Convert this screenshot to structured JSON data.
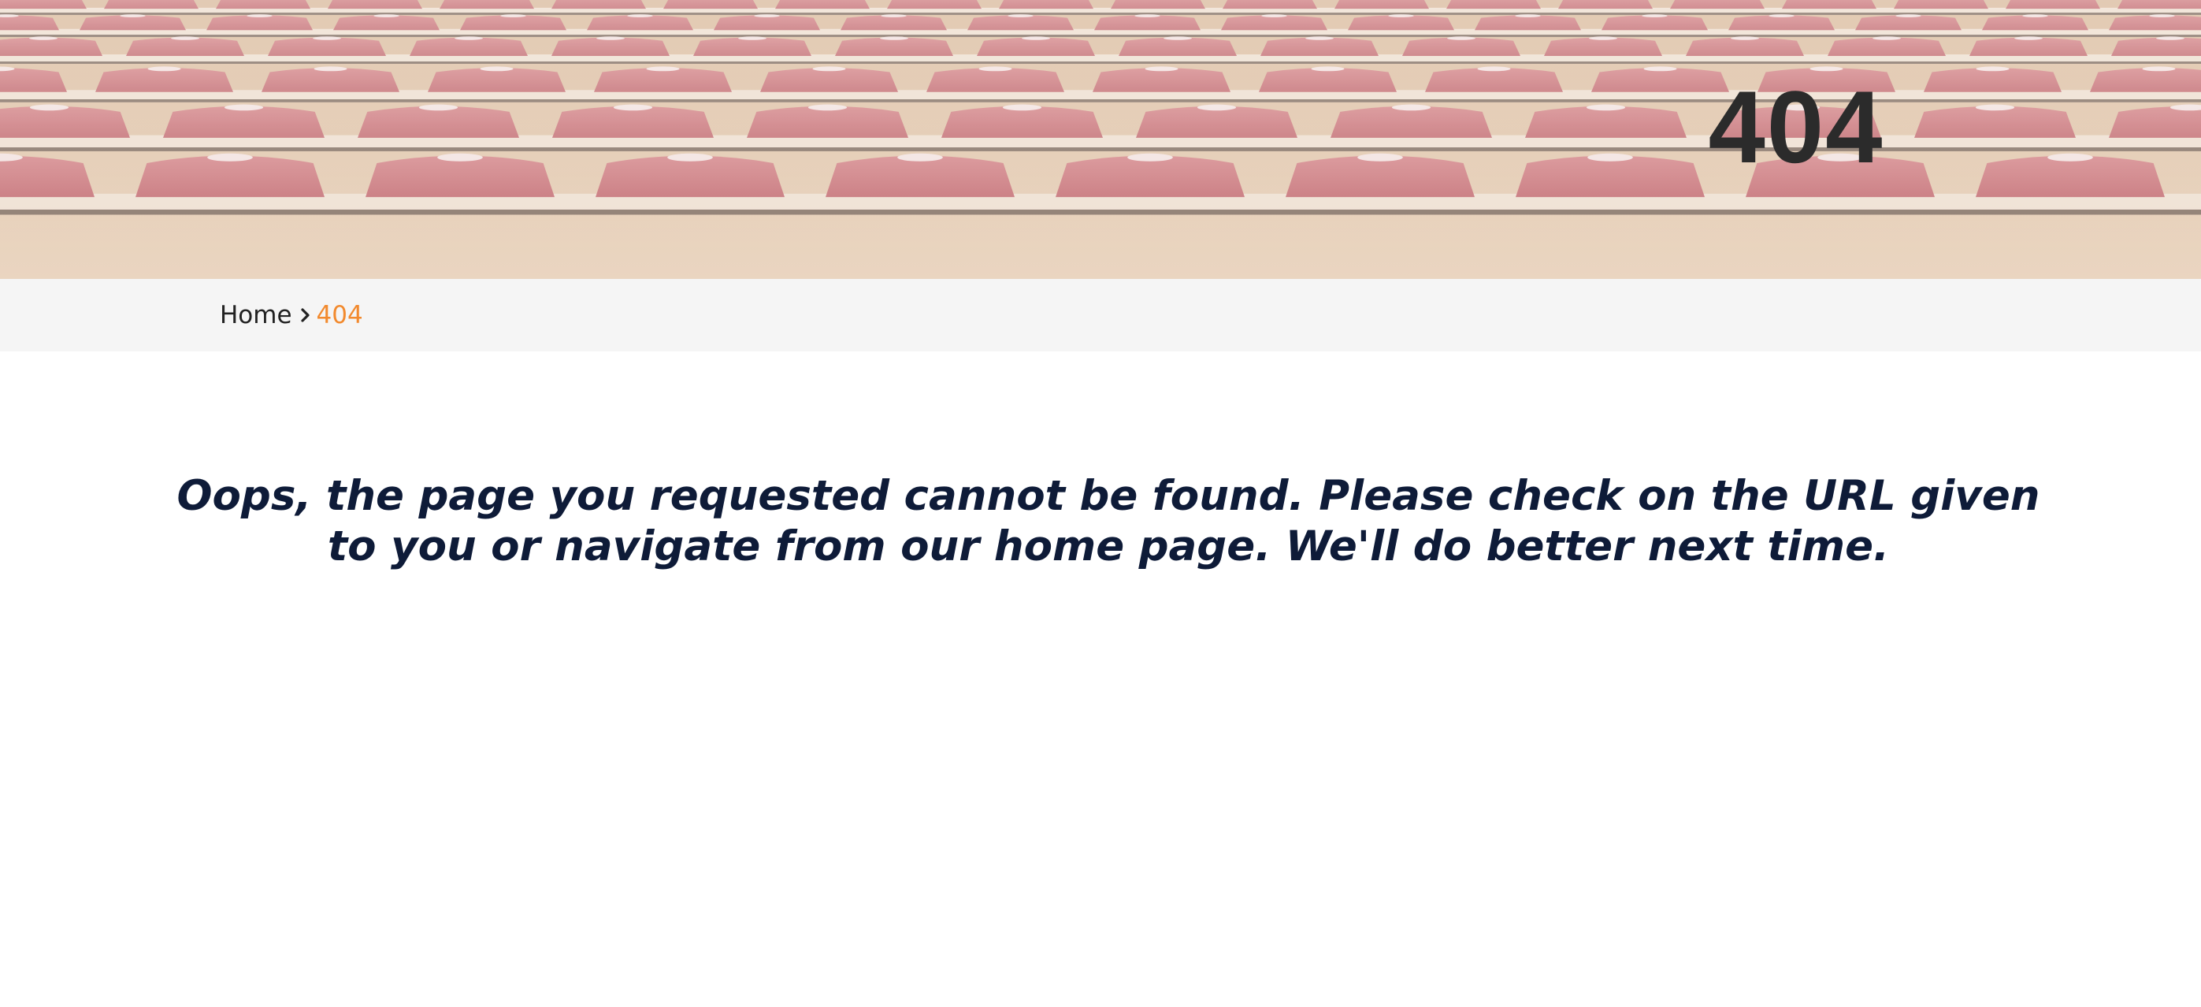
{
  "hero": {
    "title": "404"
  },
  "breadcrumb": {
    "home_label": "Home",
    "separator_icon": "chevron-right-icon",
    "current_label": "404"
  },
  "main": {
    "message": "Oops, the page you requested cannot be found. Please check on the URL given to you or navigate from our home page. We'll do better next time."
  },
  "colors": {
    "accent": "#f28a2e",
    "heading": "#0e1b38",
    "breadcrumb_bg": "#f5f5f5"
  }
}
